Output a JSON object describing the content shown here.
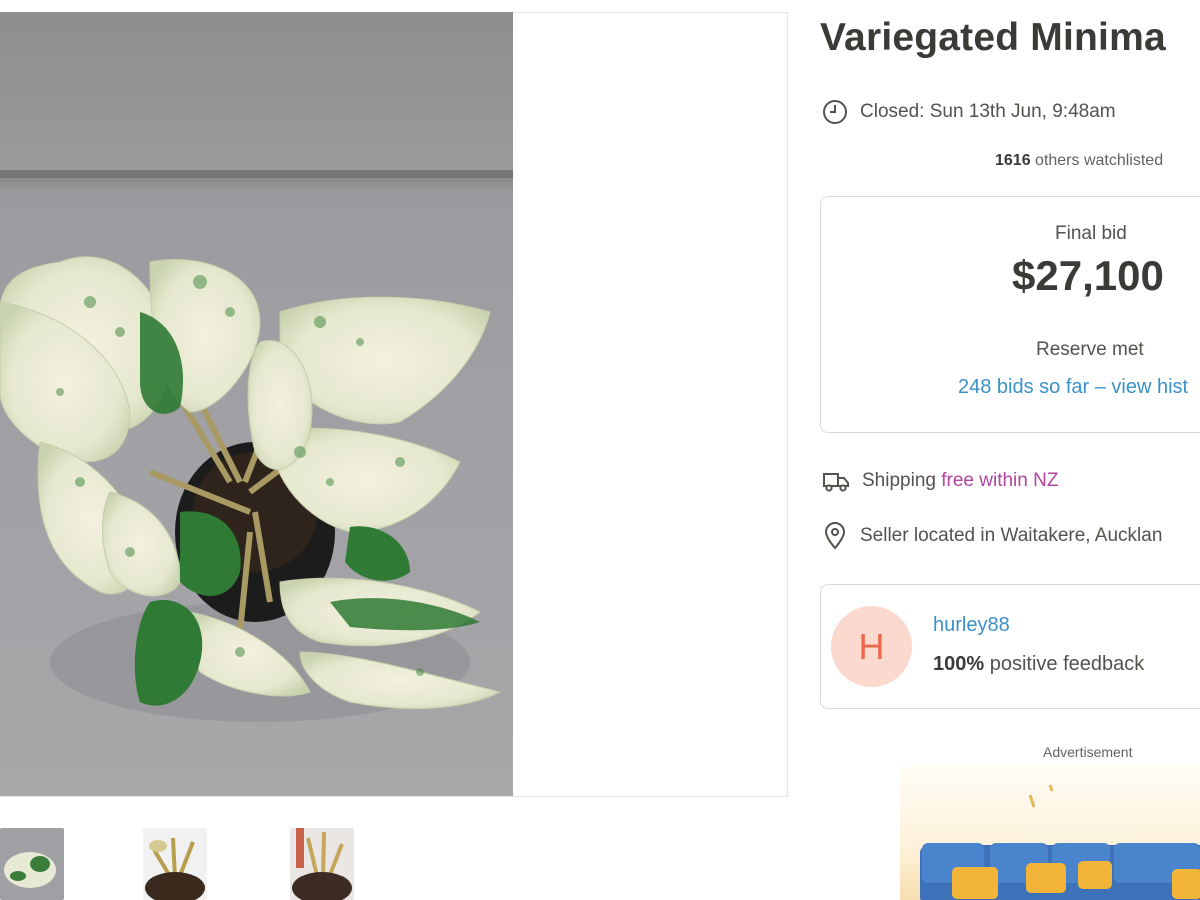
{
  "listing": {
    "title": "Variegated Minima",
    "closed": "Closed: Sun 13th Jun, 9:48am",
    "watch_count": "1616",
    "watch_suffix": " others watchlisted"
  },
  "bid": {
    "label": "Final bid",
    "amount": "$27,100",
    "reserve": "Reserve met",
    "bids_link": "248 bids so far – view hist"
  },
  "shipping": {
    "prefix": "Shipping ",
    "value": "free within NZ"
  },
  "location": {
    "text": "Seller located in Waitakere, Aucklan"
  },
  "seller": {
    "initial": "H",
    "username": "hurley88",
    "feedback_pct": "100%",
    "feedback_suffix": " positive feedback"
  },
  "advertisement": {
    "label": "Advertisement"
  },
  "icons": {
    "closed": "clock-icon",
    "shipping": "truck-icon",
    "location": "map-pin-icon"
  },
  "colors": {
    "link": "#3b92c9",
    "free_shipping": "#b0449e",
    "avatar_bg": "#fbd9cf",
    "avatar_fg": "#e9684e",
    "text": "#3c3a36"
  }
}
